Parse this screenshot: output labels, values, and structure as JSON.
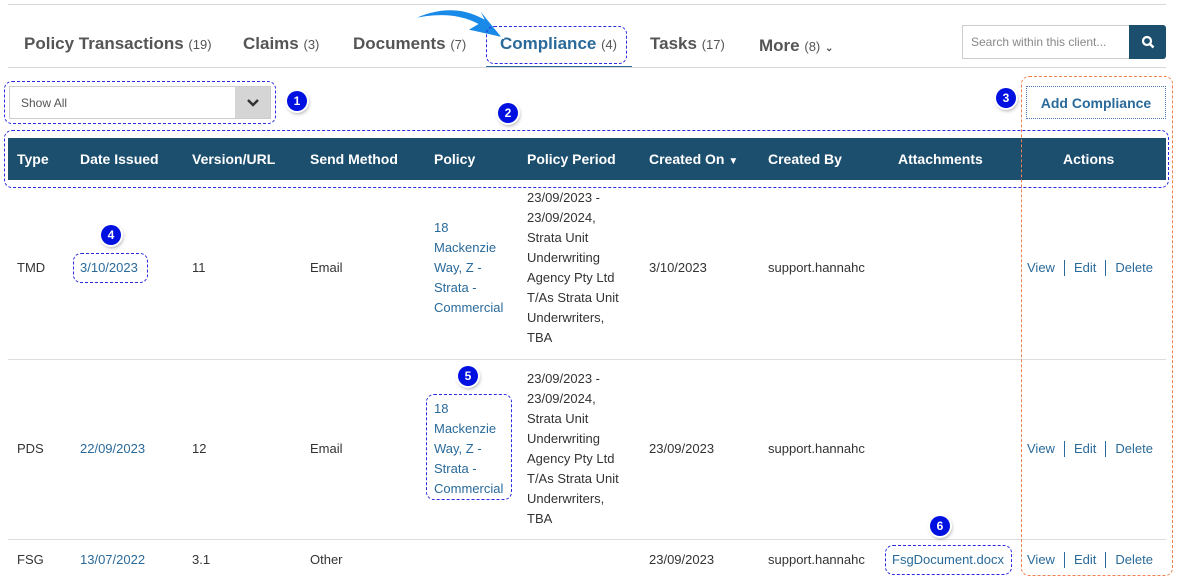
{
  "tabs": [
    {
      "label": "Policy Transactions",
      "count": "(19)"
    },
    {
      "label": "Claims",
      "count": "(3)"
    },
    {
      "label": "Documents",
      "count": "(7)"
    },
    {
      "label": "Compliance",
      "count": "(4)"
    },
    {
      "label": "Tasks",
      "count": "(17)"
    },
    {
      "label": "More",
      "count": "(8)"
    }
  ],
  "search": {
    "placeholder": "Search within this client..."
  },
  "filter": {
    "value": "Show All"
  },
  "add_button": "Add Compliance",
  "columns": [
    "Type",
    "Date Issued",
    "Version/URL",
    "Send Method",
    "Policy",
    "Policy Period",
    "Created On",
    "Created By",
    "Attachments",
    "Actions"
  ],
  "rows": [
    {
      "type": "TMD",
      "date_issued": "3/10/2023",
      "version": "11",
      "send_method": "Email",
      "policy": [
        "18",
        "Mackenzie",
        "Way, Z -",
        "Strata -",
        "Commercial"
      ],
      "period": [
        "23/09/2023 -",
        "23/09/2024,",
        "Strata Unit",
        "Underwriting",
        "Agency Pty Ltd",
        "T/As Strata Unit",
        "Underwriters,",
        "TBA"
      ],
      "created_on": "3/10/2023",
      "created_by": "support.hannahc",
      "attachment": ""
    },
    {
      "type": "PDS",
      "date_issued": "22/09/2023",
      "version": "12",
      "send_method": "Email",
      "policy": [
        "18",
        "Mackenzie",
        "Way, Z -",
        "Strata -",
        "Commercial"
      ],
      "period": [
        "23/09/2023 -",
        "23/09/2024,",
        "Strata Unit",
        "Underwriting",
        "Agency Pty Ltd",
        "T/As Strata Unit",
        "Underwriters,",
        "TBA"
      ],
      "created_on": "23/09/2023",
      "created_by": "support.hannahc",
      "attachment": ""
    },
    {
      "type": "FSG",
      "date_issued": "13/07/2022",
      "version": "3.1",
      "send_method": "Other",
      "policy": [],
      "period": [],
      "created_on": "23/09/2023",
      "created_by": "support.hannahc",
      "attachment": "FsgDocument.docx"
    }
  ],
  "actions": [
    "View",
    "Edit",
    "Delete"
  ],
  "annotations": [
    "1",
    "2",
    "3",
    "4",
    "5",
    "6"
  ],
  "colors": {
    "header": "#1c4e6e",
    "link": "#2a6a9a",
    "annotation": "#0010e0"
  }
}
